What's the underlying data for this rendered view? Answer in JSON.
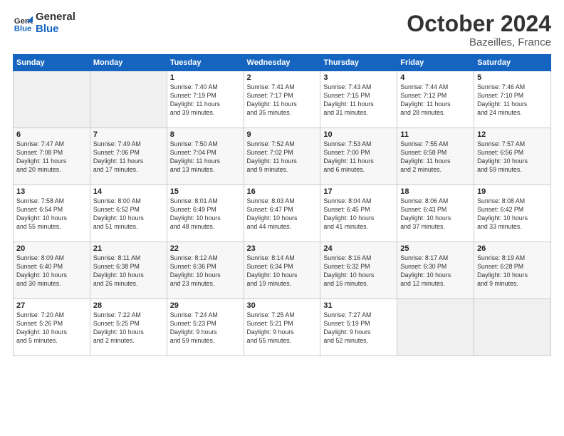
{
  "logo": {
    "line1": "General",
    "line2": "Blue"
  },
  "title": "October 2024",
  "subtitle": "Bazeilles, France",
  "days_header": [
    "Sunday",
    "Monday",
    "Tuesday",
    "Wednesday",
    "Thursday",
    "Friday",
    "Saturday"
  ],
  "weeks": [
    [
      {
        "day": "",
        "detail": ""
      },
      {
        "day": "",
        "detail": ""
      },
      {
        "day": "1",
        "detail": "Sunrise: 7:40 AM\nSunset: 7:19 PM\nDaylight: 11 hours\nand 39 minutes."
      },
      {
        "day": "2",
        "detail": "Sunrise: 7:41 AM\nSunset: 7:17 PM\nDaylight: 11 hours\nand 35 minutes."
      },
      {
        "day": "3",
        "detail": "Sunrise: 7:43 AM\nSunset: 7:15 PM\nDaylight: 11 hours\nand 31 minutes."
      },
      {
        "day": "4",
        "detail": "Sunrise: 7:44 AM\nSunset: 7:12 PM\nDaylight: 11 hours\nand 28 minutes."
      },
      {
        "day": "5",
        "detail": "Sunrise: 7:46 AM\nSunset: 7:10 PM\nDaylight: 11 hours\nand 24 minutes."
      }
    ],
    [
      {
        "day": "6",
        "detail": "Sunrise: 7:47 AM\nSunset: 7:08 PM\nDaylight: 11 hours\nand 20 minutes."
      },
      {
        "day": "7",
        "detail": "Sunrise: 7:49 AM\nSunset: 7:06 PM\nDaylight: 11 hours\nand 17 minutes."
      },
      {
        "day": "8",
        "detail": "Sunrise: 7:50 AM\nSunset: 7:04 PM\nDaylight: 11 hours\nand 13 minutes."
      },
      {
        "day": "9",
        "detail": "Sunrise: 7:52 AM\nSunset: 7:02 PM\nDaylight: 11 hours\nand 9 minutes."
      },
      {
        "day": "10",
        "detail": "Sunrise: 7:53 AM\nSunset: 7:00 PM\nDaylight: 11 hours\nand 6 minutes."
      },
      {
        "day": "11",
        "detail": "Sunrise: 7:55 AM\nSunset: 6:58 PM\nDaylight: 11 hours\nand 2 minutes."
      },
      {
        "day": "12",
        "detail": "Sunrise: 7:57 AM\nSunset: 6:56 PM\nDaylight: 10 hours\nand 59 minutes."
      }
    ],
    [
      {
        "day": "13",
        "detail": "Sunrise: 7:58 AM\nSunset: 6:54 PM\nDaylight: 10 hours\nand 55 minutes."
      },
      {
        "day": "14",
        "detail": "Sunrise: 8:00 AM\nSunset: 6:52 PM\nDaylight: 10 hours\nand 51 minutes."
      },
      {
        "day": "15",
        "detail": "Sunrise: 8:01 AM\nSunset: 6:49 PM\nDaylight: 10 hours\nand 48 minutes."
      },
      {
        "day": "16",
        "detail": "Sunrise: 8:03 AM\nSunset: 6:47 PM\nDaylight: 10 hours\nand 44 minutes."
      },
      {
        "day": "17",
        "detail": "Sunrise: 8:04 AM\nSunset: 6:45 PM\nDaylight: 10 hours\nand 41 minutes."
      },
      {
        "day": "18",
        "detail": "Sunrise: 8:06 AM\nSunset: 6:43 PM\nDaylight: 10 hours\nand 37 minutes."
      },
      {
        "day": "19",
        "detail": "Sunrise: 8:08 AM\nSunset: 6:42 PM\nDaylight: 10 hours\nand 33 minutes."
      }
    ],
    [
      {
        "day": "20",
        "detail": "Sunrise: 8:09 AM\nSunset: 6:40 PM\nDaylight: 10 hours\nand 30 minutes."
      },
      {
        "day": "21",
        "detail": "Sunrise: 8:11 AM\nSunset: 6:38 PM\nDaylight: 10 hours\nand 26 minutes."
      },
      {
        "day": "22",
        "detail": "Sunrise: 8:12 AM\nSunset: 6:36 PM\nDaylight: 10 hours\nand 23 minutes."
      },
      {
        "day": "23",
        "detail": "Sunrise: 8:14 AM\nSunset: 6:34 PM\nDaylight: 10 hours\nand 19 minutes."
      },
      {
        "day": "24",
        "detail": "Sunrise: 8:16 AM\nSunset: 6:32 PM\nDaylight: 10 hours\nand 16 minutes."
      },
      {
        "day": "25",
        "detail": "Sunrise: 8:17 AM\nSunset: 6:30 PM\nDaylight: 10 hours\nand 12 minutes."
      },
      {
        "day": "26",
        "detail": "Sunrise: 8:19 AM\nSunset: 6:28 PM\nDaylight: 10 hours\nand 9 minutes."
      }
    ],
    [
      {
        "day": "27",
        "detail": "Sunrise: 7:20 AM\nSunset: 5:26 PM\nDaylight: 10 hours\nand 5 minutes."
      },
      {
        "day": "28",
        "detail": "Sunrise: 7:22 AM\nSunset: 5:25 PM\nDaylight: 10 hours\nand 2 minutes."
      },
      {
        "day": "29",
        "detail": "Sunrise: 7:24 AM\nSunset: 5:23 PM\nDaylight: 9 hours\nand 59 minutes."
      },
      {
        "day": "30",
        "detail": "Sunrise: 7:25 AM\nSunset: 5:21 PM\nDaylight: 9 hours\nand 55 minutes."
      },
      {
        "day": "31",
        "detail": "Sunrise: 7:27 AM\nSunset: 5:19 PM\nDaylight: 9 hours\nand 52 minutes."
      },
      {
        "day": "",
        "detail": ""
      },
      {
        "day": "",
        "detail": ""
      }
    ]
  ]
}
